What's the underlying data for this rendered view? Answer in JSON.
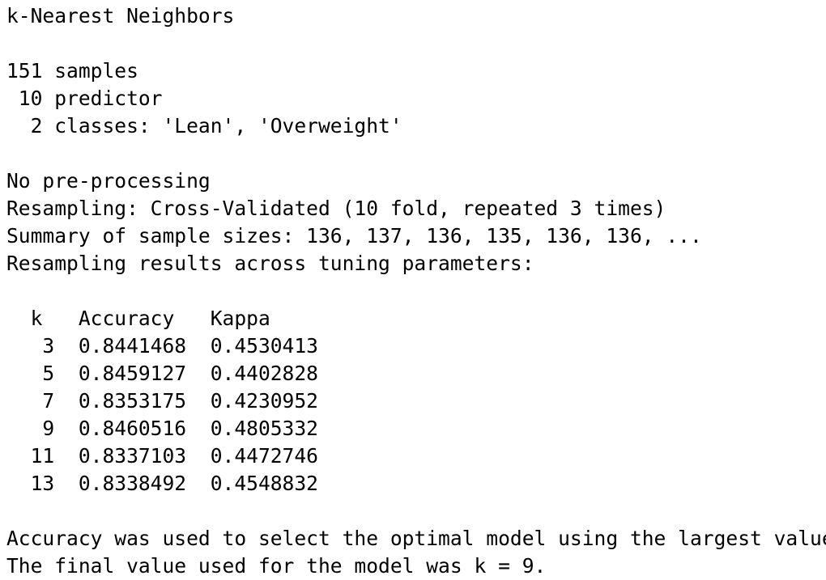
{
  "output": {
    "lines": [
      "k-Nearest Neighbors",
      "",
      "151 samples",
      " 10 predictor",
      "  2 classes: 'Lean', 'Overweight'",
      "",
      "No pre-processing",
      "Resampling: Cross-Validated (10 fold, repeated 3 times)",
      "Summary of sample sizes: 136, 137, 136, 135, 136, 136, ...",
      "Resampling results across tuning parameters:",
      "",
      "  k   Accuracy   Kappa",
      "   3  0.8441468  0.4530413",
      "   5  0.8459127  0.4402828",
      "   7  0.8353175  0.4230952",
      "   9  0.8460516  0.4805332",
      "  11  0.8337103  0.4472746",
      "  13  0.8338492  0.4548832",
      "",
      "Accuracy was used to select the optimal model using the largest value.",
      "The final value used for the model was k = 9."
    ]
  }
}
